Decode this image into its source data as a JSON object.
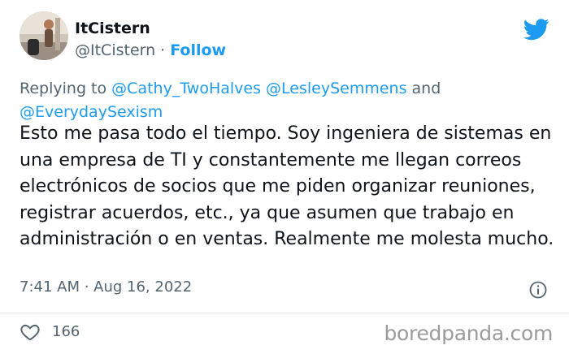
{
  "author": {
    "display_name": "ItCistern",
    "handle": "@ItCistern",
    "separator": "·",
    "follow_label": "Follow"
  },
  "reply": {
    "prefix": "Replying to",
    "mention_1": "@Cathy_TwoHalves",
    "mention_2": "@LesleySemmens",
    "conjunction": "and",
    "mention_3": "@EverydaySexism"
  },
  "tweet": {
    "text": "Esto me pasa todo el tiempo. Soy ingeniera de sistemas en una empresa de TI y constantemente me llegan correos electrónicos de socios que me piden organizar reuniones, registrar acuerdos, etc., ya que asumen que trabajo en administración o en ventas. Realmente me molesta mucho.",
    "timestamp": "7:41 AM · Aug 16, 2022"
  },
  "engagement": {
    "likes": "166"
  },
  "watermark": "boredpanda.com",
  "colors": {
    "accent": "#1d9bf0",
    "secondary_text": "#536471",
    "primary_text": "#0f1419"
  },
  "icons": {
    "brand": "twitter-bird-icon",
    "info": "info-icon",
    "like": "heart-icon"
  }
}
